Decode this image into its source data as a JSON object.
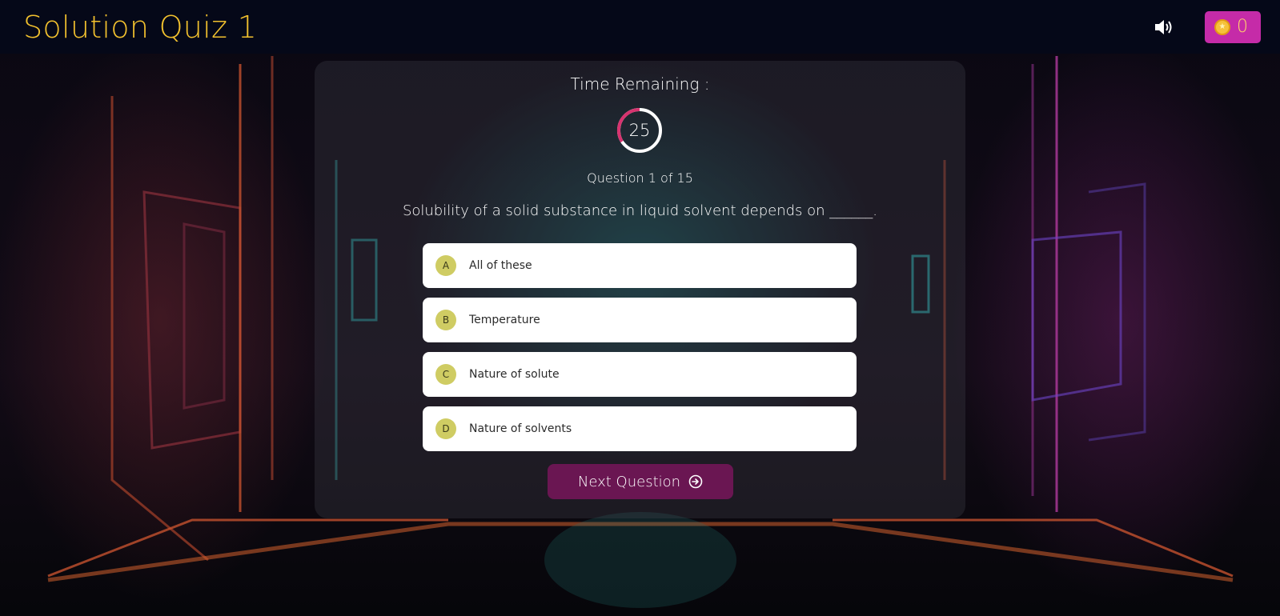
{
  "header": {
    "title": "Solution Quiz 1",
    "sound_icon": "volume-icon",
    "coin_icon": "coin-icon",
    "coins": "0"
  },
  "quiz": {
    "time_label": "Time Remaining :",
    "time_remaining": "25",
    "progress_text": "Question 1 of 15",
    "question": "Solubility of a solid substance in liquid solvent depends on ______.",
    "options": [
      {
        "letter": "A",
        "text": "All of these"
      },
      {
        "letter": "B",
        "text": "Temperature"
      },
      {
        "letter": "C",
        "text": "Nature of solute"
      },
      {
        "letter": "D",
        "text": "Nature of solvents"
      }
    ],
    "next_label": "Next Question",
    "next_icon": "arrow-circle-right-icon"
  },
  "colors": {
    "title": "#f2c12e",
    "coin_badge": "#c52ba8",
    "next_button": "#6a1652",
    "option_letter_bg": "#cfcc63",
    "timer_ring": "#d7336f"
  }
}
